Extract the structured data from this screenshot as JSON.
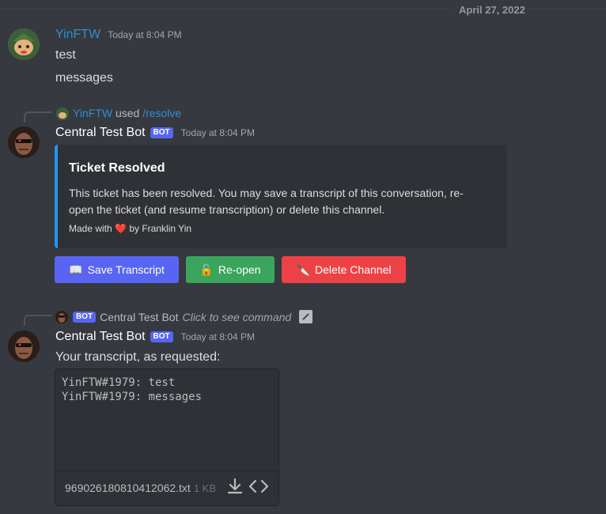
{
  "date_divider": "April 27, 2022",
  "messages": [
    {
      "author": "YinFTW",
      "timestamp": "Today at 8:04 PM",
      "lines": [
        "test",
        "messages"
      ]
    },
    {
      "reply": {
        "user": "YinFTW",
        "verb": "used",
        "command": "/resolve"
      },
      "author": "Central Test Bot",
      "bot_tag": "BOT",
      "timestamp": "Today at 8:04 PM",
      "embed": {
        "title": "Ticket Resolved",
        "description": "This ticket has been resolved. You may save a transcript of this conversation, re-open the ticket (and resume transcription) or delete this channel.",
        "footer_prefix": "Made with",
        "footer_heart": "❤️",
        "footer_suffix": "by Franklin Yin",
        "accent_color": "#2196f3"
      },
      "buttons": [
        {
          "emoji": "📖",
          "label": "Save Transcript",
          "color": "#5865f2"
        },
        {
          "emoji": "🔓",
          "label": "Re-open",
          "color": "#3ba55d"
        },
        {
          "emoji": "🔪",
          "label": "Delete Channel",
          "color": "#ed4245"
        }
      ]
    },
    {
      "reply": {
        "bot_tag": "BOT",
        "user": "Central Test Bot",
        "hint": "Click to see command"
      },
      "author": "Central Test Bot",
      "bot_tag": "BOT",
      "timestamp": "Today at 8:04 PM",
      "text": "Your transcript, as requested:",
      "attachment": {
        "lines": [
          "YinFTW#1979: test",
          "YinFTW#1979: messages"
        ],
        "filename": "969026180810412062.txt",
        "size": "1 KB",
        "icons": [
          "download-icon",
          "code-expand-icon"
        ]
      }
    }
  ]
}
